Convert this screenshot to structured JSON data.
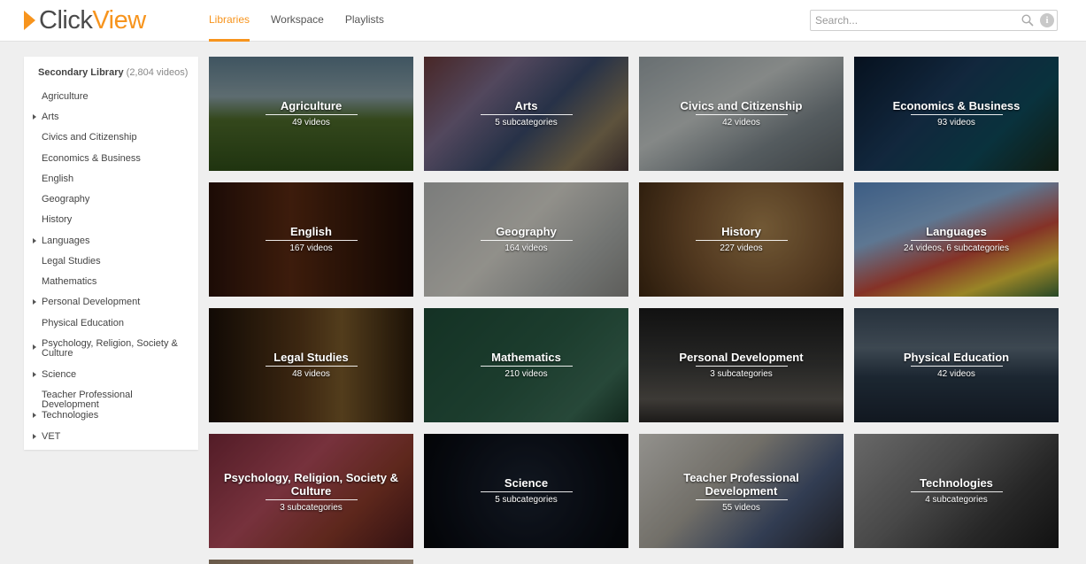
{
  "header": {
    "logo": {
      "part1": "Click",
      "part2": "View"
    },
    "nav": [
      {
        "label": "Libraries",
        "active": true
      },
      {
        "label": "Workspace",
        "active": false
      },
      {
        "label": "Playlists",
        "active": false
      }
    ],
    "search": {
      "placeholder": "Search..."
    },
    "icons": {
      "search": "search-icon",
      "info": "info-icon"
    },
    "info_glyph": "i"
  },
  "sidebar": {
    "title": "Secondary Library",
    "count": "(2,804 videos)",
    "items": [
      {
        "label": "Agriculture",
        "expandable": false
      },
      {
        "label": "Arts",
        "expandable": true
      },
      {
        "label": "Civics and Citizenship",
        "expandable": false
      },
      {
        "label": "Economics & Business",
        "expandable": false
      },
      {
        "label": "English",
        "expandable": false
      },
      {
        "label": "Geography",
        "expandable": false
      },
      {
        "label": "History",
        "expandable": false
      },
      {
        "label": "Languages",
        "expandable": true
      },
      {
        "label": "Legal Studies",
        "expandable": false
      },
      {
        "label": "Mathematics",
        "expandable": false
      },
      {
        "label": "Personal Development",
        "expandable": true
      },
      {
        "label": "Physical Education",
        "expandable": false
      },
      {
        "label": "Psychology, Religion, Society & Culture",
        "expandable": true
      },
      {
        "label": "Science",
        "expandable": true
      },
      {
        "label": "Teacher Professional Development",
        "expandable": false
      },
      {
        "label": "Technologies",
        "expandable": true
      },
      {
        "label": "VET",
        "expandable": true
      }
    ]
  },
  "tiles": [
    {
      "title": "Agriculture",
      "subtitle": "49 videos"
    },
    {
      "title": "Arts",
      "subtitle": "5 subcategories"
    },
    {
      "title": "Civics and Citizenship",
      "subtitle": "42 videos"
    },
    {
      "title": "Economics & Business",
      "subtitle": "93 videos"
    },
    {
      "title": "English",
      "subtitle": "167 videos"
    },
    {
      "title": "Geography",
      "subtitle": "164 videos"
    },
    {
      "title": "History",
      "subtitle": "227 videos"
    },
    {
      "title": "Languages",
      "subtitle": "24 videos, 6 subcategories"
    },
    {
      "title": "Legal Studies",
      "subtitle": "48 videos"
    },
    {
      "title": "Mathematics",
      "subtitle": "210 videos"
    },
    {
      "title": "Personal Development",
      "subtitle": "3 subcategories"
    },
    {
      "title": "Physical Education",
      "subtitle": "42 videos"
    },
    {
      "title": "Psychology, Religion, Society & Culture",
      "subtitle": "3 subcategories"
    },
    {
      "title": "Science",
      "subtitle": "5 subcategories"
    },
    {
      "title": "Teacher Professional Development",
      "subtitle": "55 videos"
    },
    {
      "title": "Technologies",
      "subtitle": "4 subcategories"
    }
  ],
  "colors": {
    "accent": "#f7941d",
    "background": "#efefef"
  }
}
